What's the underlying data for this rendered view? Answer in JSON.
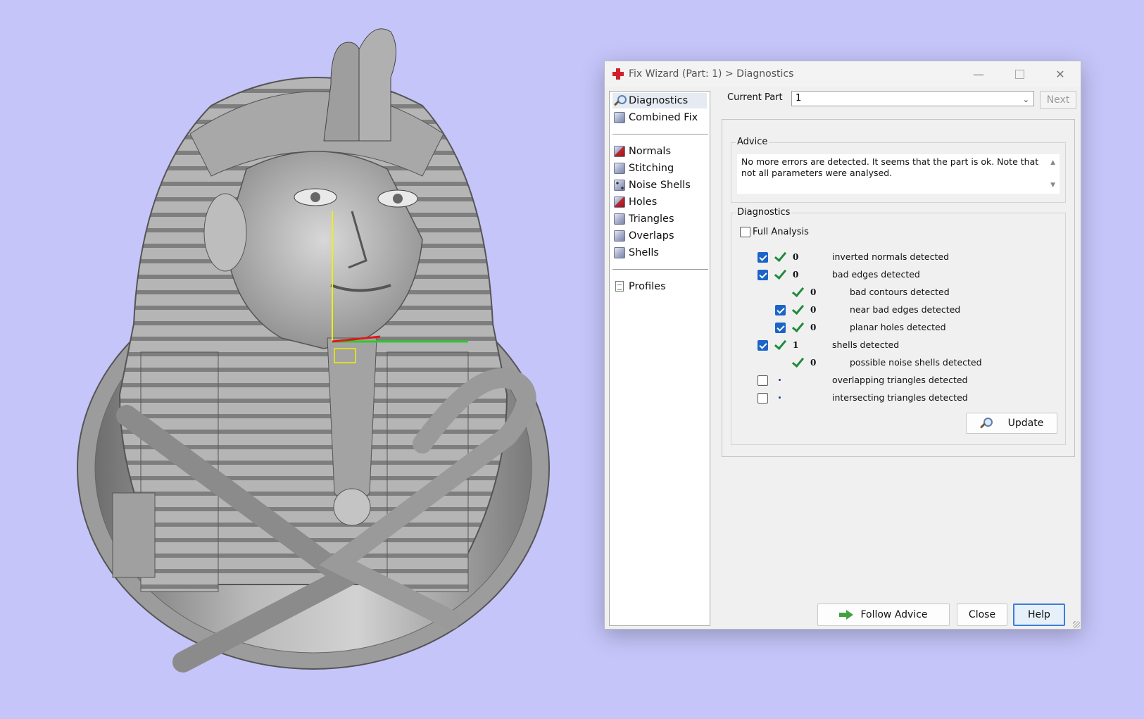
{
  "window": {
    "title": "Fix Wizard (Part: 1) > Diagnostics",
    "minimize": "—",
    "close": "✕"
  },
  "nav": {
    "items": [
      {
        "label": "Diagnostics"
      },
      {
        "label": "Combined Fix"
      },
      {
        "label": "Normals"
      },
      {
        "label": "Stitching"
      },
      {
        "label": "Noise Shells"
      },
      {
        "label": "Holes"
      },
      {
        "label": "Triangles"
      },
      {
        "label": "Overlaps"
      },
      {
        "label": "Shells"
      },
      {
        "label": "Profiles"
      }
    ],
    "selected": "Diagnostics"
  },
  "header": {
    "current_part_label": "Current Part",
    "current_part_value": "1",
    "next_label": "Next"
  },
  "advice": {
    "title": "Advice",
    "text": "No more errors are detected. It seems that the part is ok. Note that not all parameters were analysed."
  },
  "diagnostics": {
    "title": "Diagnostics",
    "full_analysis_label": "Full Analysis",
    "full_analysis_checked": false,
    "rows": [
      {
        "checked": true,
        "status": "ok",
        "count": "0",
        "text": "inverted normals detected"
      },
      {
        "checked": true,
        "status": "ok",
        "count": "0",
        "text": "bad edges detected"
      },
      {
        "checked": null,
        "status": "ok",
        "count": "0",
        "text": "bad contours detected"
      },
      {
        "checked": true,
        "status": "ok",
        "count": "0",
        "text": "near bad edges detected"
      },
      {
        "checked": true,
        "status": "ok",
        "count": "0",
        "text": "planar holes detected"
      },
      {
        "checked": true,
        "status": "ok",
        "count": "1",
        "text": "shells detected"
      },
      {
        "checked": null,
        "status": "ok",
        "count": "0",
        "text": "possible noise shells detected"
      },
      {
        "checked": false,
        "status": "not-analysed",
        "count": "",
        "text": "overlapping triangles detected"
      },
      {
        "checked": false,
        "status": "not-analysed",
        "count": "",
        "text": "intersecting triangles detected"
      }
    ],
    "update_label": "Update"
  },
  "footer": {
    "follow_advice_label": "Follow Advice",
    "close_label": "Close",
    "help_label": "Help"
  },
  "colors": {
    "viewport_background": "#c5c5fa",
    "check_green": "#1f8a3a",
    "checkbox_blue": "#1b64c8"
  }
}
